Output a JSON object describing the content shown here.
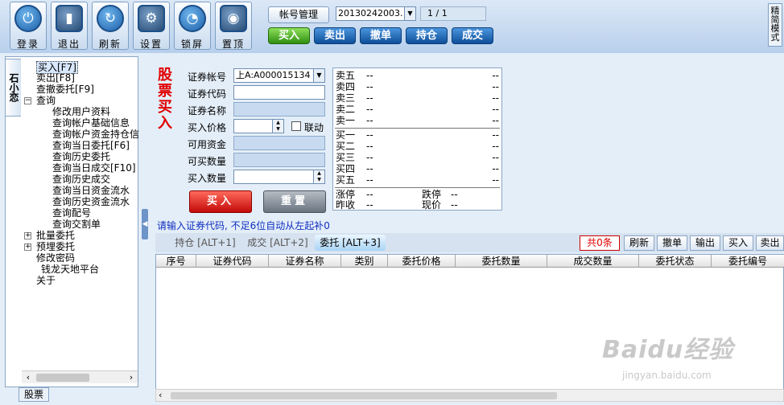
{
  "toolbar": {
    "buttons": [
      {
        "label": "登录",
        "icon": "power-icon"
      },
      {
        "label": "退出",
        "icon": "exit-icon"
      },
      {
        "label": "刷新",
        "icon": "refresh-icon"
      },
      {
        "label": "设置",
        "icon": "settings-icon"
      },
      {
        "label": "锁屏",
        "icon": "lock-icon"
      },
      {
        "label": "置顶",
        "icon": "pin-top-icon"
      }
    ],
    "account_manage": "帐号管理",
    "account_select": "20130242003.",
    "page_indicator": "1 / 1",
    "trade_buttons": [
      "买入",
      "卖出",
      "撤单",
      "持仓",
      "成交"
    ],
    "mode_tab": "精简模式"
  },
  "left": {
    "vertical_tab": "石小恋",
    "tree": [
      "买入[F7]",
      "卖出[F8]",
      "查撤委托[F9]",
      "查询",
      "修改用户资料",
      "查询帐户基础信息",
      "查询帐户资金持仓信",
      "查询当日委托[F6]",
      "查询历史委托",
      "查询当日成交[F10]",
      "查询历史成交",
      "查询当日资金流水",
      "查询历史资金流水",
      "查询配号",
      "查询交割单",
      "批量委托",
      "预埋委托",
      "修改密码",
      "钱龙天地平台",
      "关于"
    ],
    "bottom_tab": "股票"
  },
  "form": {
    "title": "股票买入",
    "labels": [
      "证券帐号",
      "证券代码",
      "证券名称",
      "买入价格",
      "可用资金",
      "可买数量",
      "买入数量"
    ],
    "account_value": "上A:A000015134",
    "link_label": "联动",
    "buy_button": "买入",
    "reset_button": "重置"
  },
  "quote": {
    "sell": [
      {
        "label": "卖五",
        "p": "--",
        "v": "--"
      },
      {
        "label": "卖四",
        "p": "--",
        "v": "--"
      },
      {
        "label": "卖三",
        "p": "--",
        "v": "--"
      },
      {
        "label": "卖二",
        "p": "--",
        "v": "--"
      },
      {
        "label": "卖一",
        "p": "--",
        "v": "--"
      }
    ],
    "buy": [
      {
        "label": "买一",
        "p": "--",
        "v": "--"
      },
      {
        "label": "买二",
        "p": "--",
        "v": "--"
      },
      {
        "label": "买三",
        "p": "--",
        "v": "--"
      },
      {
        "label": "买四",
        "p": "--",
        "v": "--"
      },
      {
        "label": "买五",
        "p": "--",
        "v": "--"
      }
    ],
    "limit_up_label": "涨停",
    "limit_up": "--",
    "limit_down_label": "跌停",
    "limit_down": "--",
    "prev_close_label": "昨收",
    "prev_close": "--",
    "current_label": "现价",
    "current": "--"
  },
  "hint": "请输入证券代码, 不足6位自动从左起补0",
  "bottom": {
    "tabs": [
      "持仓 [ALT+1]",
      "成交 [ALT+2]",
      "委托 [ALT+3]"
    ],
    "count": "共0条",
    "actions": [
      "刷新",
      "撤单",
      "输出",
      "买入",
      "卖出"
    ],
    "columns": [
      "序号",
      "证券代码",
      "证券名称",
      "类别",
      "委托价格",
      "委托数量",
      "成交数量",
      "委托状态",
      "委托编号"
    ]
  },
  "watermark": {
    "text": "Baidu经验",
    "url": "jingyan.baidu.com"
  }
}
